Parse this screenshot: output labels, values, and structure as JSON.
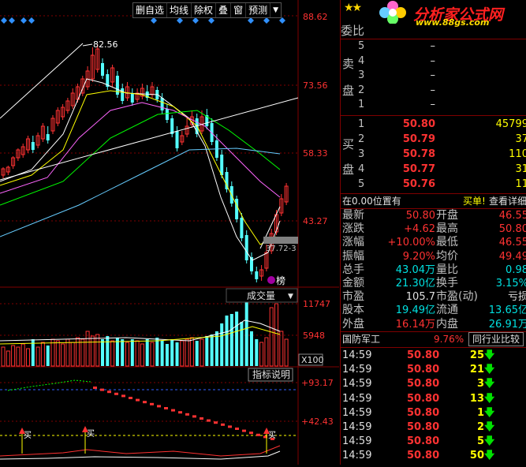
{
  "toolbar": {
    "items": [
      "删自选",
      "均线",
      "除权",
      "叠",
      "窗",
      "预测"
    ],
    "arrow": "▼"
  },
  "kline": {
    "price_labels": [
      "88.62",
      "73.56",
      "58.33",
      "43.27"
    ],
    "high_mark": "82.56",
    "low_mark": "37.72-3",
    "badge": "榜"
  },
  "volume": {
    "title": "成交量",
    "labels": [
      "11747",
      "5948"
    ],
    "unit": "X100"
  },
  "indicator": {
    "button": "指标说明",
    "labels": [
      "+93.17",
      "+42.43"
    ],
    "buy_label": "买"
  },
  "logo": {
    "stars": "★★",
    "text": "分析家公式网",
    "url": "www.88gs.com"
  },
  "orderbook": {
    "committee_label": "委比",
    "sell_label": [
      "卖",
      "盘"
    ],
    "buy_label": [
      "买",
      "盘"
    ],
    "sell": [
      {
        "lvl": "5",
        "price": "–",
        "vol": ""
      },
      {
        "lvl": "4",
        "price": "–",
        "vol": ""
      },
      {
        "lvl": "3",
        "price": "–",
        "vol": ""
      },
      {
        "lvl": "2",
        "price": "–",
        "vol": ""
      },
      {
        "lvl": "1",
        "price": "–",
        "vol": ""
      }
    ],
    "buy": [
      {
        "lvl": "1",
        "price": "50.80",
        "vol": "45799"
      },
      {
        "lvl": "2",
        "price": "50.79",
        "vol": "37"
      },
      {
        "lvl": "3",
        "price": "50.78",
        "vol": "110"
      },
      {
        "lvl": "4",
        "price": "50.77",
        "vol": "31"
      },
      {
        "lvl": "5",
        "price": "50.76",
        "vol": "11"
      }
    ]
  },
  "position_info": {
    "left": "在0.00位置有",
    "right": "买单!",
    "link": "查看详细"
  },
  "quote": {
    "rows": [
      {
        "l1": "最新",
        "v1": "50.80",
        "c1": "red",
        "l2": "开盘",
        "v2": "46.55",
        "c2": "red"
      },
      {
        "l1": "涨跌",
        "v1": "+4.62",
        "c1": "red",
        "l2": "最高",
        "v2": "50.80",
        "c2": "red"
      },
      {
        "l1": "涨幅",
        "v1": "+10.00%",
        "c1": "red",
        "l2": "最低",
        "v2": "46.55",
        "c2": "red"
      },
      {
        "l1": "振幅",
        "v1": "9.20%",
        "c1": "red",
        "l2": "均价",
        "v2": "49.49",
        "c2": "red"
      },
      {
        "l1": "总手",
        "v1": "43.04万",
        "c1": "cyan",
        "l2": "量比",
        "v2": "0.98",
        "c2": "cyan"
      },
      {
        "l1": "金额",
        "v1": "21.30亿",
        "c1": "cyan",
        "l2": "换手",
        "v2": "3.15%",
        "c2": "cyan"
      },
      {
        "l1": "市盈",
        "v1": "105.7",
        "c1": "white",
        "l2": "市盈(动)",
        "v2": "亏损",
        "c2": "white"
      },
      {
        "l1": "股本",
        "v1": "19.49亿",
        "c1": "cyan",
        "l2": "流通",
        "v2": "13.65亿",
        "c2": "cyan"
      },
      {
        "l1": "外盘",
        "v1": "16.14万",
        "c1": "red",
        "l2": "内盘",
        "v2": "26.91万",
        "c2": "cyan"
      }
    ]
  },
  "sector": {
    "name": "国防军工",
    "change": "9.76%",
    "compare_button": "同行业比较"
  },
  "ticks": [
    {
      "time": "14:59",
      "price": "50.80",
      "vol": "25"
    },
    {
      "time": "14:59",
      "price": "50.80",
      "vol": "21"
    },
    {
      "time": "14:59",
      "price": "50.80",
      "vol": "3"
    },
    {
      "time": "14:59",
      "price": "50.80",
      "vol": "13"
    },
    {
      "time": "14:59",
      "price": "50.80",
      "vol": "1"
    },
    {
      "time": "14:59",
      "price": "50.80",
      "vol": "2"
    },
    {
      "time": "14:59",
      "price": "50.80",
      "vol": "5"
    },
    {
      "time": "14:59",
      "price": "50.80",
      "vol": "50"
    }
  ],
  "colors": {
    "up": "#ff3232",
    "down": "#54ffff",
    "accent": "#7f0000"
  }
}
